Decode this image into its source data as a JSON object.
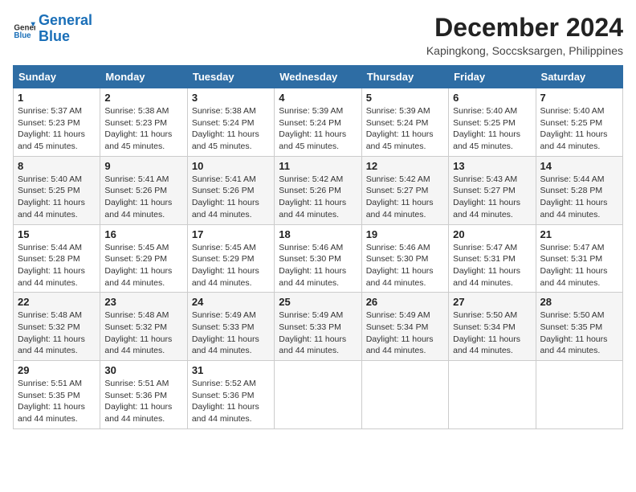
{
  "logo": {
    "text_general": "General",
    "text_blue": "Blue"
  },
  "title": "December 2024",
  "location": "Kapingkong, Soccsksargen, Philippines",
  "days_of_week": [
    "Sunday",
    "Monday",
    "Tuesday",
    "Wednesday",
    "Thursday",
    "Friday",
    "Saturday"
  ],
  "weeks": [
    [
      {
        "day": "1",
        "sunrise": "5:37 AM",
        "sunset": "5:23 PM",
        "daylight": "11 hours and 45 minutes."
      },
      {
        "day": "2",
        "sunrise": "5:38 AM",
        "sunset": "5:23 PM",
        "daylight": "11 hours and 45 minutes."
      },
      {
        "day": "3",
        "sunrise": "5:38 AM",
        "sunset": "5:24 PM",
        "daylight": "11 hours and 45 minutes."
      },
      {
        "day": "4",
        "sunrise": "5:39 AM",
        "sunset": "5:24 PM",
        "daylight": "11 hours and 45 minutes."
      },
      {
        "day": "5",
        "sunrise": "5:39 AM",
        "sunset": "5:24 PM",
        "daylight": "11 hours and 45 minutes."
      },
      {
        "day": "6",
        "sunrise": "5:40 AM",
        "sunset": "5:25 PM",
        "daylight": "11 hours and 45 minutes."
      },
      {
        "day": "7",
        "sunrise": "5:40 AM",
        "sunset": "5:25 PM",
        "daylight": "11 hours and 44 minutes."
      }
    ],
    [
      {
        "day": "8",
        "sunrise": "5:40 AM",
        "sunset": "5:25 PM",
        "daylight": "11 hours and 44 minutes."
      },
      {
        "day": "9",
        "sunrise": "5:41 AM",
        "sunset": "5:26 PM",
        "daylight": "11 hours and 44 minutes."
      },
      {
        "day": "10",
        "sunrise": "5:41 AM",
        "sunset": "5:26 PM",
        "daylight": "11 hours and 44 minutes."
      },
      {
        "day": "11",
        "sunrise": "5:42 AM",
        "sunset": "5:26 PM",
        "daylight": "11 hours and 44 minutes."
      },
      {
        "day": "12",
        "sunrise": "5:42 AM",
        "sunset": "5:27 PM",
        "daylight": "11 hours and 44 minutes."
      },
      {
        "day": "13",
        "sunrise": "5:43 AM",
        "sunset": "5:27 PM",
        "daylight": "11 hours and 44 minutes."
      },
      {
        "day": "14",
        "sunrise": "5:44 AM",
        "sunset": "5:28 PM",
        "daylight": "11 hours and 44 minutes."
      }
    ],
    [
      {
        "day": "15",
        "sunrise": "5:44 AM",
        "sunset": "5:28 PM",
        "daylight": "11 hours and 44 minutes."
      },
      {
        "day": "16",
        "sunrise": "5:45 AM",
        "sunset": "5:29 PM",
        "daylight": "11 hours and 44 minutes."
      },
      {
        "day": "17",
        "sunrise": "5:45 AM",
        "sunset": "5:29 PM",
        "daylight": "11 hours and 44 minutes."
      },
      {
        "day": "18",
        "sunrise": "5:46 AM",
        "sunset": "5:30 PM",
        "daylight": "11 hours and 44 minutes."
      },
      {
        "day": "19",
        "sunrise": "5:46 AM",
        "sunset": "5:30 PM",
        "daylight": "11 hours and 44 minutes."
      },
      {
        "day": "20",
        "sunrise": "5:47 AM",
        "sunset": "5:31 PM",
        "daylight": "11 hours and 44 minutes."
      },
      {
        "day": "21",
        "sunrise": "5:47 AM",
        "sunset": "5:31 PM",
        "daylight": "11 hours and 44 minutes."
      }
    ],
    [
      {
        "day": "22",
        "sunrise": "5:48 AM",
        "sunset": "5:32 PM",
        "daylight": "11 hours and 44 minutes."
      },
      {
        "day": "23",
        "sunrise": "5:48 AM",
        "sunset": "5:32 PM",
        "daylight": "11 hours and 44 minutes."
      },
      {
        "day": "24",
        "sunrise": "5:49 AM",
        "sunset": "5:33 PM",
        "daylight": "11 hours and 44 minutes."
      },
      {
        "day": "25",
        "sunrise": "5:49 AM",
        "sunset": "5:33 PM",
        "daylight": "11 hours and 44 minutes."
      },
      {
        "day": "26",
        "sunrise": "5:49 AM",
        "sunset": "5:34 PM",
        "daylight": "11 hours and 44 minutes."
      },
      {
        "day": "27",
        "sunrise": "5:50 AM",
        "sunset": "5:34 PM",
        "daylight": "11 hours and 44 minutes."
      },
      {
        "day": "28",
        "sunrise": "5:50 AM",
        "sunset": "5:35 PM",
        "daylight": "11 hours and 44 minutes."
      }
    ],
    [
      {
        "day": "29",
        "sunrise": "5:51 AM",
        "sunset": "5:35 PM",
        "daylight": "11 hours and 44 minutes."
      },
      {
        "day": "30",
        "sunrise": "5:51 AM",
        "sunset": "5:36 PM",
        "daylight": "11 hours and 44 minutes."
      },
      {
        "day": "31",
        "sunrise": "5:52 AM",
        "sunset": "5:36 PM",
        "daylight": "11 hours and 44 minutes."
      },
      null,
      null,
      null,
      null
    ]
  ]
}
